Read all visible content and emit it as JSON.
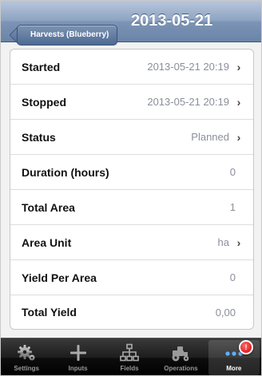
{
  "navbar": {
    "back_label": "Harvests (Blueberry)",
    "title": "2013-05-21"
  },
  "rows": [
    {
      "label": "Started",
      "value": "2013-05-21 20:19",
      "has_chevron": true
    },
    {
      "label": "Stopped",
      "value": "2013-05-21 20:19",
      "has_chevron": true
    },
    {
      "label": "Status",
      "value": "Planned",
      "has_chevron": true
    },
    {
      "label": "Duration (hours)",
      "value": "0",
      "has_chevron": false
    },
    {
      "label": "Total Area",
      "value": "1",
      "has_chevron": false
    },
    {
      "label": "Area Unit",
      "value": "ha",
      "has_chevron": true
    },
    {
      "label": "Yield Per Area",
      "value": "0",
      "has_chevron": false
    },
    {
      "label": "Total Yield",
      "value": "0,00",
      "has_chevron": false
    }
  ],
  "chevron_glyph": "›",
  "tabbar": {
    "tabs": [
      {
        "label": "Settings",
        "icon": "gear-icon"
      },
      {
        "label": "Inputs",
        "icon": "plus-icon"
      },
      {
        "label": "Fields",
        "icon": "fields-hierarchy-icon"
      },
      {
        "label": "Operations",
        "icon": "tractor-icon"
      },
      {
        "label": "More",
        "icon": "more-dots-icon",
        "selected": true
      }
    ],
    "badge": "!"
  },
  "colors": {
    "navbar_accent": "#7c94b5",
    "value_text": "#8a8f9a",
    "badge_red": "#d20000"
  }
}
